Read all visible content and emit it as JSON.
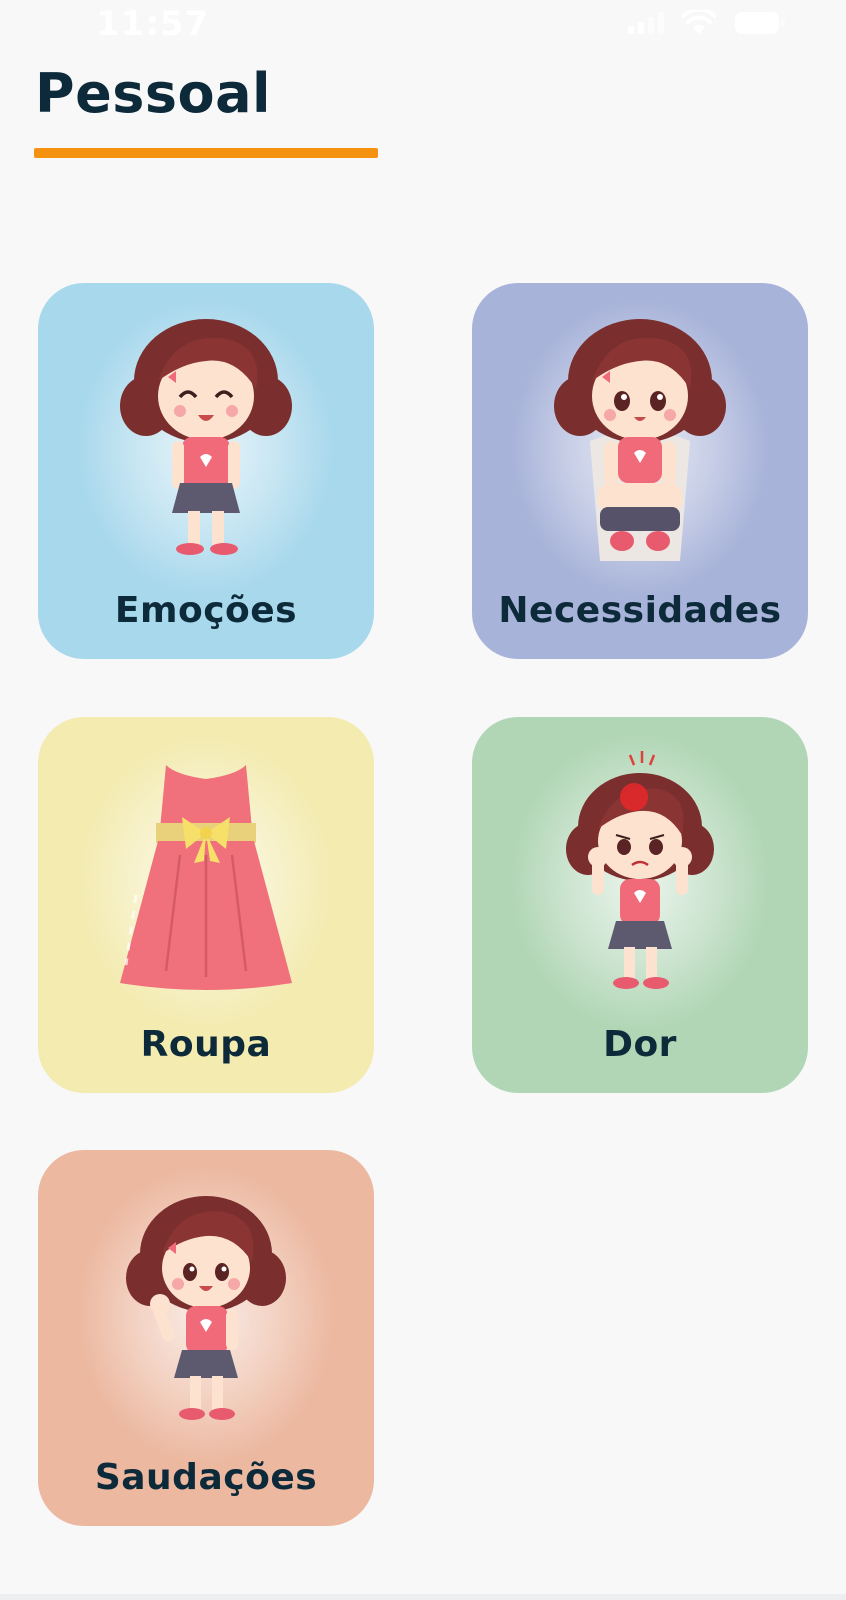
{
  "status_bar": {
    "time": "11:57",
    "signal_icon": "cellular-signal-icon",
    "wifi_icon": "wifi-icon",
    "battery_icon": "battery-icon"
  },
  "header": {
    "title": "Pessoal",
    "accent_color": "#f5920f"
  },
  "categories": [
    {
      "label": "Emoções",
      "color": "#a8d8ec",
      "illustration": "happy-girl-illustration"
    },
    {
      "label": "Necessidades",
      "color": "#a8b3d9",
      "illustration": "girl-on-toilet-illustration"
    },
    {
      "label": "Roupa",
      "color": "#f3ebb0",
      "illustration": "pink-dress-illustration"
    },
    {
      "label": "Dor",
      "color": "#b1d6b6",
      "illustration": "girl-headache-illustration"
    },
    {
      "label": "Saudações",
      "color": "#ecb8a0",
      "illustration": "girl-waving-illustration"
    }
  ]
}
